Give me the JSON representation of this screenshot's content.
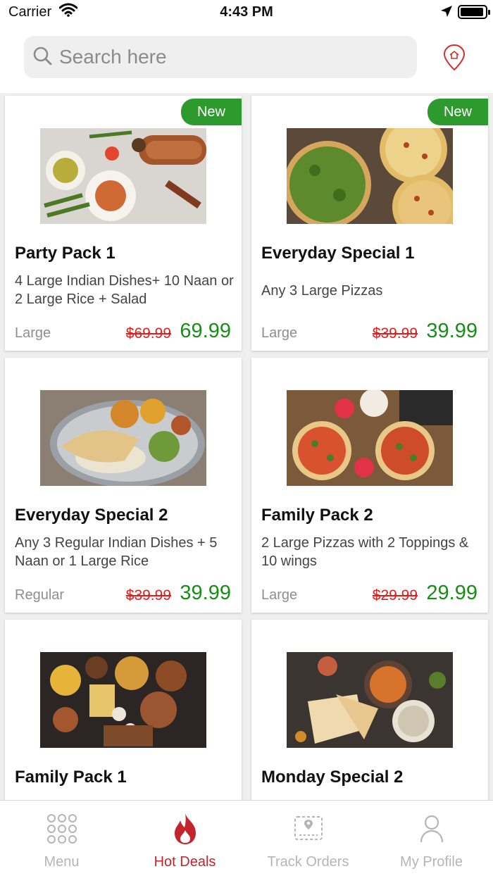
{
  "status_bar": {
    "carrier": "Carrier",
    "time": "4:43 PM"
  },
  "search": {
    "placeholder": "Search here",
    "value": ""
  },
  "colors": {
    "accent_red": "#c4242b",
    "badge_green": "#2c9a2c",
    "price_green": "#159015",
    "old_price_red": "#e01e1e"
  },
  "deals": [
    {
      "badge": "New",
      "title": "Party Pack 1",
      "description": "4 Large Indian Dishes+ 10 Naan or 2 Large Rice + Salad",
      "size": "Large",
      "old_price": "$69.99",
      "price": "69.99",
      "image": "indian-dishes-spread-photo"
    },
    {
      "badge": "New",
      "title": "Everyday Special 1",
      "description": "Any 3 Large Pizzas",
      "size": "Large",
      "old_price": "$39.99",
      "price": "39.99",
      "image": "pizzas-photo"
    },
    {
      "badge": "",
      "title": "Everyday Special 2",
      "description": "Any 3 Regular Indian Dishes + 5 Naan or 1 Large Rice",
      "size": "Regular",
      "old_price": "$39.99",
      "price": "39.99",
      "image": "thali-plate-photo"
    },
    {
      "badge": "",
      "title": "Family Pack 2",
      "description": "2 Large Pizzas with 2 Toppings & 10 wings",
      "size": "Large",
      "old_price": "$29.99",
      "price": "29.99",
      "image": "pizza-table-photo"
    },
    {
      "badge": "",
      "title": "Family Pack 1",
      "description": "",
      "size": "",
      "old_price": "",
      "price": "",
      "image": "indian-feast-photo"
    },
    {
      "badge": "",
      "title": "Monday Special 2",
      "description": "",
      "size": "",
      "old_price": "",
      "price": "",
      "image": "curry-naan-photo"
    }
  ],
  "tabs": [
    {
      "label": "Menu",
      "icon": "grid-dots-icon",
      "active": false
    },
    {
      "label": "Hot Deals",
      "icon": "flame-icon",
      "active": true
    },
    {
      "label": "Track Orders",
      "icon": "route-map-icon",
      "active": false
    },
    {
      "label": "My Profile",
      "icon": "person-icon",
      "active": false
    }
  ]
}
